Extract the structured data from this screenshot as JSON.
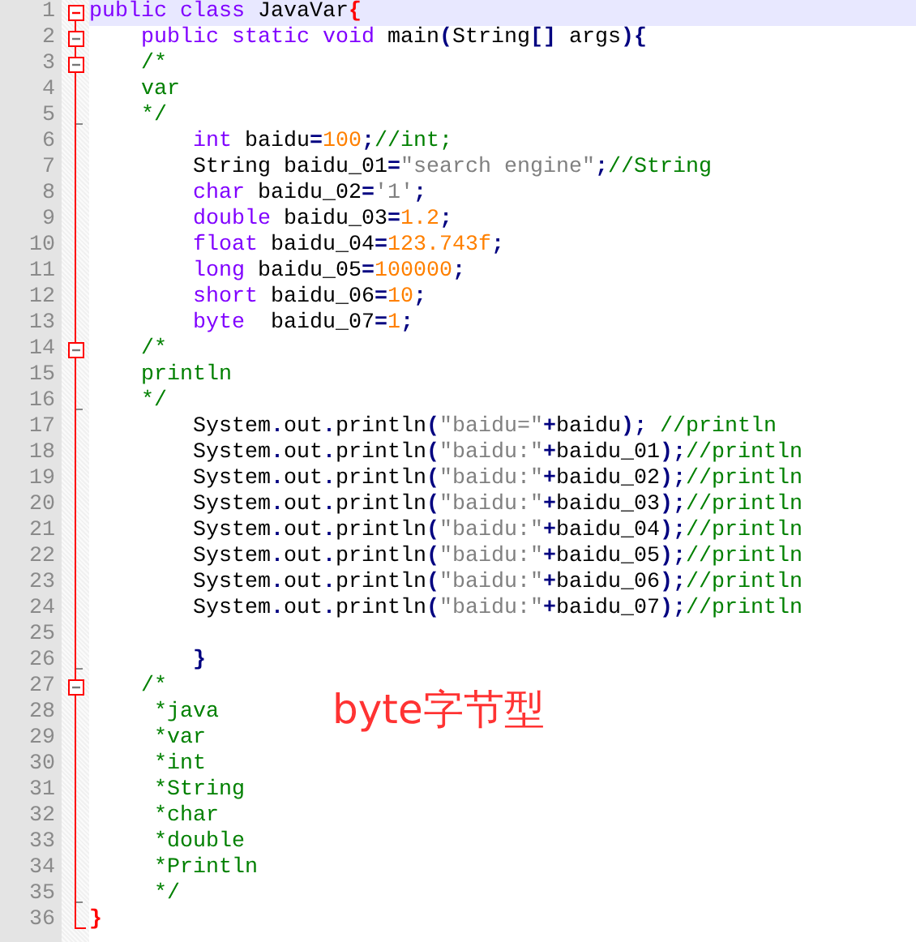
{
  "lines": [
    {
      "number": "1",
      "kind": "fold-start",
      "current": true,
      "tokens": [
        {
          "kind": "keyword",
          "text": "public class"
        },
        {
          "kind": "plain",
          "text": " JavaVar"
        },
        {
          "kind": "brace",
          "text": "{"
        }
      ],
      "children": [
        {
          "number": "2",
          "kind": "fold-start",
          "current": false,
          "tokens": [
            {
              "kind": "keyword",
              "text": "public static void"
            },
            {
              "kind": "plain",
              "text": " main"
            },
            {
              "kind": "op",
              "text": "("
            },
            {
              "kind": "plain",
              "text": "String"
            },
            {
              "kind": "op",
              "text": "[]"
            },
            {
              "kind": "plain",
              "text": " args"
            },
            {
              "kind": "op",
              "text": "){"
            }
          ]
        },
        {
          "number": "3",
          "kind": "fold-start",
          "current": false,
          "tokens": [
            {
              "kind": "comment",
              "text": "/*"
            }
          ]
        },
        {
          "number": "4",
          "kind": "fold-line",
          "current": false,
          "tokens": [
            {
              "kind": "comment",
              "text": "var"
            }
          ]
        },
        {
          "number": "5",
          "kind": "fold-end",
          "current": false,
          "tokens": [
            {
              "kind": "comment",
              "text": "*/"
            }
          ],
          "children": [
            {
              "number": "6",
              "kind": "fold-line",
              "current": false,
              "tokens": [
                {
                  "kind": "keyword",
                  "text": "int"
                },
                {
                  "kind": "plain",
                  "text": " baidu"
                },
                {
                  "kind": "op",
                  "text": "="
                },
                {
                  "kind": "number",
                  "text": "100"
                },
                {
                  "kind": "op",
                  "text": ";"
                },
                {
                  "kind": "comment",
                  "text": "//int;"
                }
              ]
            },
            {
              "number": "7",
              "kind": "fold-line",
              "current": false,
              "tokens": [
                {
                  "kind": "plain",
                  "text": "String baidu_01"
                },
                {
                  "kind": "op",
                  "text": "="
                },
                {
                  "kind": "string",
                  "text": "\"search engine\""
                },
                {
                  "kind": "op",
                  "text": ";"
                },
                {
                  "kind": "comment",
                  "text": "//String"
                }
              ]
            },
            {
              "number": "8",
              "kind": "fold-line",
              "current": false,
              "tokens": [
                {
                  "kind": "keyword",
                  "text": "char"
                },
                {
                  "kind": "plain",
                  "text": " baidu_02"
                },
                {
                  "kind": "op",
                  "text": "="
                },
                {
                  "kind": "string",
                  "text": "'1'"
                },
                {
                  "kind": "op",
                  "text": ";"
                }
              ]
            },
            {
              "number": "9",
              "kind": "fold-line",
              "current": false,
              "tokens": [
                {
                  "kind": "keyword",
                  "text": "double"
                },
                {
                  "kind": "plain",
                  "text": " baidu_03"
                },
                {
                  "kind": "op",
                  "text": "="
                },
                {
                  "kind": "number",
                  "text": "1.2"
                },
                {
                  "kind": "op",
                  "text": ";"
                }
              ]
            },
            {
              "number": "10",
              "kind": "fold-line",
              "current": false,
              "tokens": [
                {
                  "kind": "keyword",
                  "text": "float"
                },
                {
                  "kind": "plain",
                  "text": " baidu_04"
                },
                {
                  "kind": "op",
                  "text": "="
                },
                {
                  "kind": "number",
                  "text": "123.743f"
                },
                {
                  "kind": "op",
                  "text": ";"
                }
              ]
            },
            {
              "number": "11",
              "kind": "fold-line",
              "current": false,
              "tokens": [
                {
                  "kind": "keyword",
                  "text": "long"
                },
                {
                  "kind": "plain",
                  "text": " baidu_05"
                },
                {
                  "kind": "op",
                  "text": "="
                },
                {
                  "kind": "number",
                  "text": "100000"
                },
                {
                  "kind": "op",
                  "text": ";"
                }
              ]
            },
            {
              "number": "12",
              "kind": "fold-line",
              "current": false,
              "tokens": [
                {
                  "kind": "keyword",
                  "text": "short"
                },
                {
                  "kind": "plain",
                  "text": " baidu_06"
                },
                {
                  "kind": "op",
                  "text": "="
                },
                {
                  "kind": "number",
                  "text": "10"
                },
                {
                  "kind": "op",
                  "text": ";"
                }
              ]
            },
            {
              "number": "13",
              "kind": "fold-line",
              "current": false,
              "tokens": [
                {
                  "kind": "keyword",
                  "text": "byte"
                },
                {
                  "kind": "plain",
                  "text": "  baidu_07"
                },
                {
                  "kind": "op",
                  "text": "="
                },
                {
                  "kind": "number",
                  "text": "1"
                },
                {
                  "kind": "op",
                  "text": ";"
                }
              ]
            }
          ]
        },
        {
          "number": "14",
          "kind": "fold-start",
          "current": false,
          "tokens": [
            {
              "kind": "comment",
              "text": "/*"
            }
          ]
        },
        {
          "number": "15",
          "kind": "fold-line",
          "current": false,
          "tokens": [
            {
              "kind": "comment",
              "text": "println"
            }
          ]
        },
        {
          "number": "16",
          "kind": "fold-end",
          "current": false,
          "tokens": [
            {
              "kind": "comment",
              "text": "*/"
            }
          ],
          "children": [
            {
              "number": "17",
              "kind": "fold-line",
              "current": false,
              "tokens": [
                {
                  "kind": "plain",
                  "text": "System"
                },
                {
                  "kind": "op",
                  "text": "."
                },
                {
                  "kind": "plain",
                  "text": "out"
                },
                {
                  "kind": "op",
                  "text": "."
                },
                {
                  "kind": "plain",
                  "text": "println"
                },
                {
                  "kind": "op",
                  "text": "("
                },
                {
                  "kind": "string",
                  "text": "\"baidu=\""
                },
                {
                  "kind": "op",
                  "text": "+"
                },
                {
                  "kind": "plain",
                  "text": "baidu"
                },
                {
                  "kind": "op",
                  "text": ");"
                },
                {
                  "kind": "comment",
                  "text": " //println"
                }
              ]
            },
            {
              "number": "18",
              "kind": "fold-line",
              "current": false,
              "tokens": [
                {
                  "kind": "plain",
                  "text": "System"
                },
                {
                  "kind": "op",
                  "text": "."
                },
                {
                  "kind": "plain",
                  "text": "out"
                },
                {
                  "kind": "op",
                  "text": "."
                },
                {
                  "kind": "plain",
                  "text": "println"
                },
                {
                  "kind": "op",
                  "text": "("
                },
                {
                  "kind": "string",
                  "text": "\"baidu:\""
                },
                {
                  "kind": "op",
                  "text": "+"
                },
                {
                  "kind": "plain",
                  "text": "baidu_01"
                },
                {
                  "kind": "op",
                  "text": ");"
                },
                {
                  "kind": "comment",
                  "text": "//println"
                }
              ]
            },
            {
              "number": "19",
              "kind": "fold-line",
              "current": false,
              "tokens": [
                {
                  "kind": "plain",
                  "text": "System"
                },
                {
                  "kind": "op",
                  "text": "."
                },
                {
                  "kind": "plain",
                  "text": "out"
                },
                {
                  "kind": "op",
                  "text": "."
                },
                {
                  "kind": "plain",
                  "text": "println"
                },
                {
                  "kind": "op",
                  "text": "("
                },
                {
                  "kind": "string",
                  "text": "\"baidu:\""
                },
                {
                  "kind": "op",
                  "text": "+"
                },
                {
                  "kind": "plain",
                  "text": "baidu_02"
                },
                {
                  "kind": "op",
                  "text": ");"
                },
                {
                  "kind": "comment",
                  "text": "//println"
                }
              ]
            },
            {
              "number": "20",
              "kind": "fold-line",
              "current": false,
              "tokens": [
                {
                  "kind": "plain",
                  "text": "System"
                },
                {
                  "kind": "op",
                  "text": "."
                },
                {
                  "kind": "plain",
                  "text": "out"
                },
                {
                  "kind": "op",
                  "text": "."
                },
                {
                  "kind": "plain",
                  "text": "println"
                },
                {
                  "kind": "op",
                  "text": "("
                },
                {
                  "kind": "string",
                  "text": "\"baidu:\""
                },
                {
                  "kind": "op",
                  "text": "+"
                },
                {
                  "kind": "plain",
                  "text": "baidu_03"
                },
                {
                  "kind": "op",
                  "text": ");"
                },
                {
                  "kind": "comment",
                  "text": "//println"
                }
              ]
            },
            {
              "number": "21",
              "kind": "fold-line",
              "current": false,
              "tokens": [
                {
                  "kind": "plain",
                  "text": "System"
                },
                {
                  "kind": "op",
                  "text": "."
                },
                {
                  "kind": "plain",
                  "text": "out"
                },
                {
                  "kind": "op",
                  "text": "."
                },
                {
                  "kind": "plain",
                  "text": "println"
                },
                {
                  "kind": "op",
                  "text": "("
                },
                {
                  "kind": "string",
                  "text": "\"baidu:\""
                },
                {
                  "kind": "op",
                  "text": "+"
                },
                {
                  "kind": "plain",
                  "text": "baidu_04"
                },
                {
                  "kind": "op",
                  "text": ");"
                },
                {
                  "kind": "comment",
                  "text": "//println"
                }
              ]
            },
            {
              "number": "22",
              "kind": "fold-line",
              "current": false,
              "tokens": [
                {
                  "kind": "plain",
                  "text": "System"
                },
                {
                  "kind": "op",
                  "text": "."
                },
                {
                  "kind": "plain",
                  "text": "out"
                },
                {
                  "kind": "op",
                  "text": "."
                },
                {
                  "kind": "plain",
                  "text": "println"
                },
                {
                  "kind": "op",
                  "text": "("
                },
                {
                  "kind": "string",
                  "text": "\"baidu:\""
                },
                {
                  "kind": "op",
                  "text": "+"
                },
                {
                  "kind": "plain",
                  "text": "baidu_05"
                },
                {
                  "kind": "op",
                  "text": ");"
                },
                {
                  "kind": "comment",
                  "text": "//println"
                }
              ]
            },
            {
              "number": "23",
              "kind": "fold-line",
              "current": false,
              "tokens": [
                {
                  "kind": "plain",
                  "text": "System"
                },
                {
                  "kind": "op",
                  "text": "."
                },
                {
                  "kind": "plain",
                  "text": "out"
                },
                {
                  "kind": "op",
                  "text": "."
                },
                {
                  "kind": "plain",
                  "text": "println"
                },
                {
                  "kind": "op",
                  "text": "("
                },
                {
                  "kind": "string",
                  "text": "\"baidu:\""
                },
                {
                  "kind": "op",
                  "text": "+"
                },
                {
                  "kind": "plain",
                  "text": "baidu_06"
                },
                {
                  "kind": "op",
                  "text": ");"
                },
                {
                  "kind": "comment",
                  "text": "//println"
                }
              ]
            },
            {
              "number": "24",
              "kind": "fold-line",
              "current": false,
              "tokens": [
                {
                  "kind": "plain",
                  "text": "System"
                },
                {
                  "kind": "op",
                  "text": "."
                },
                {
                  "kind": "plain",
                  "text": "out"
                },
                {
                  "kind": "op",
                  "text": "."
                },
                {
                  "kind": "plain",
                  "text": "println"
                },
                {
                  "kind": "op",
                  "text": "("
                },
                {
                  "kind": "string",
                  "text": "\"baidu:\""
                },
                {
                  "kind": "op",
                  "text": "+"
                },
                {
                  "kind": "plain",
                  "text": "baidu_07"
                },
                {
                  "kind": "op",
                  "text": ");"
                },
                {
                  "kind": "comment",
                  "text": "//println"
                }
              ]
            },
            {
              "number": "25",
              "kind": "fold-line",
              "current": false
            },
            {
              "number": "26",
              "kind": "fold-end",
              "current": false,
              "tokens": [
                {
                  "kind": "op",
                  "text": "}"
                }
              ]
            }
          ]
        },
        {
          "number": "27",
          "kind": "fold-start",
          "current": false,
          "tokens": [
            {
              "kind": "comment",
              "text": "/*"
            }
          ]
        },
        {
          "number": "28",
          "kind": "fold-line",
          "current": false,
          "tokens": [
            {
              "kind": "comment",
              "text": " *java"
            }
          ]
        },
        {
          "number": "29",
          "kind": "fold-line",
          "current": false,
          "tokens": [
            {
              "kind": "comment",
              "text": " *var"
            }
          ]
        },
        {
          "number": "30",
          "kind": "fold-line",
          "current": false,
          "tokens": [
            {
              "kind": "comment",
              "text": " *int"
            }
          ]
        },
        {
          "number": "31",
          "kind": "fold-line",
          "current": false,
          "tokens": [
            {
              "kind": "comment",
              "text": " *String"
            }
          ]
        },
        {
          "number": "32",
          "kind": "fold-line",
          "current": false,
          "tokens": [
            {
              "kind": "comment",
              "text": " *char"
            }
          ]
        },
        {
          "number": "33",
          "kind": "fold-line",
          "current": false,
          "tokens": [
            {
              "kind": "comment",
              "text": " *double"
            }
          ]
        },
        {
          "number": "34",
          "kind": "fold-line",
          "current": false,
          "tokens": [
            {
              "kind": "comment",
              "text": " *Println"
            }
          ]
        },
        {
          "number": "35",
          "kind": "fold-end",
          "current": false,
          "tokens": [
            {
              "kind": "comment",
              "text": " */"
            }
          ]
        }
      ]
    },
    {
      "number": "36",
      "kind": "fold-last",
      "current": false,
      "tokens": [
        {
          "kind": "brace",
          "text": "}"
        }
      ]
    }
  ],
  "annotation": {
    "text": "byte字节型"
  }
}
